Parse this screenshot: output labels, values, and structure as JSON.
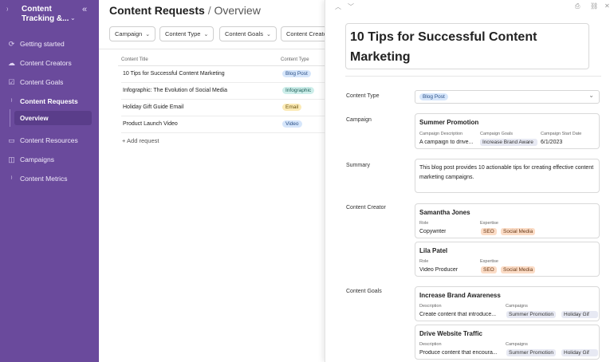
{
  "sidebar": {
    "workspace": "Content Tracking &...",
    "items": [
      {
        "label": "Getting started",
        "icon": "rocket-icon"
      },
      {
        "label": "Content Creators",
        "icon": "cloud-icon"
      },
      {
        "label": "Content Goals",
        "icon": "checkbox-icon"
      },
      {
        "label": "Content Requests",
        "icon": "rss-icon"
      },
      {
        "label": "Content Resources",
        "icon": "monitor-icon"
      },
      {
        "label": "Campaigns",
        "icon": "megaphone-icon"
      },
      {
        "label": "Content Metrics",
        "icon": "signal-icon"
      }
    ],
    "sub_item": "Overview"
  },
  "header": {
    "title": "Content Requests",
    "separator": "/",
    "subtitle": "Overview"
  },
  "filters": [
    "Campaign",
    "Content Type",
    "Content Goals",
    "Content Creato"
  ],
  "table": {
    "columns": [
      "Content Title",
      "Content Type"
    ],
    "rows": [
      {
        "title": "10 Tips for Successful Content Marketing",
        "type": "Blog Post"
      },
      {
        "title": "Infographic: The Evolution of Social Media",
        "type": "Infographic"
      },
      {
        "title": "Holiday Gift Guide Email",
        "type": "Email"
      },
      {
        "title": "Product Launch Video",
        "type": "Video"
      }
    ],
    "add_label": "+ Add request"
  },
  "panel": {
    "title": "10 Tips for Successful Content Marketing",
    "labels": {
      "content_type": "Content Type",
      "campaign": "Campaign",
      "summary": "Summary",
      "creator": "Content Creator",
      "goals": "Content Goals"
    },
    "content_type": "Blog Post",
    "campaign": {
      "name": "Summer Promotion",
      "desc_label": "Campaign Description",
      "desc": "A campaign to drive...",
      "goals_label": "Campaign Goals",
      "goals": "Increase Brand Aware",
      "start_label": "Campaign Start Date",
      "start": "6/1/2023"
    },
    "summary": "This blog post provides 10 actionable tips for creating effective content marketing campaigns.",
    "creators": [
      {
        "name": "Samantha Jones",
        "role_label": "Role",
        "role": "Copywriter",
        "exp_label": "Expertise",
        "tags": [
          "SEO",
          "Social Media"
        ]
      },
      {
        "name": "Lila Patel",
        "role_label": "Role",
        "role": "Video Producer",
        "exp_label": "Expertise",
        "tags": [
          "SEO",
          "Social Media"
        ]
      }
    ],
    "goals": [
      {
        "name": "Increase Brand Awareness",
        "desc_label": "Description",
        "desc": "Create content that introduce...",
        "camp_label": "Campaigns",
        "camps": [
          "Summer Promotion",
          "Holiday Gif"
        ]
      },
      {
        "name": "Drive Website Traffic",
        "desc_label": "Description",
        "desc": "Produce content that encoura...",
        "camp_label": "Campaigns",
        "camps": [
          "Summer Promotion",
          "Holiday Gif"
        ]
      }
    ]
  },
  "colors": {
    "sidebar_bg": "#6a4a9c",
    "tag_blue": "#d6e6fb",
    "tag_teal": "#cdeeea",
    "tag_yellow": "#fbeab6",
    "tag_orange": "#fbdcc6",
    "tag_grey": "#e7e9f3"
  }
}
